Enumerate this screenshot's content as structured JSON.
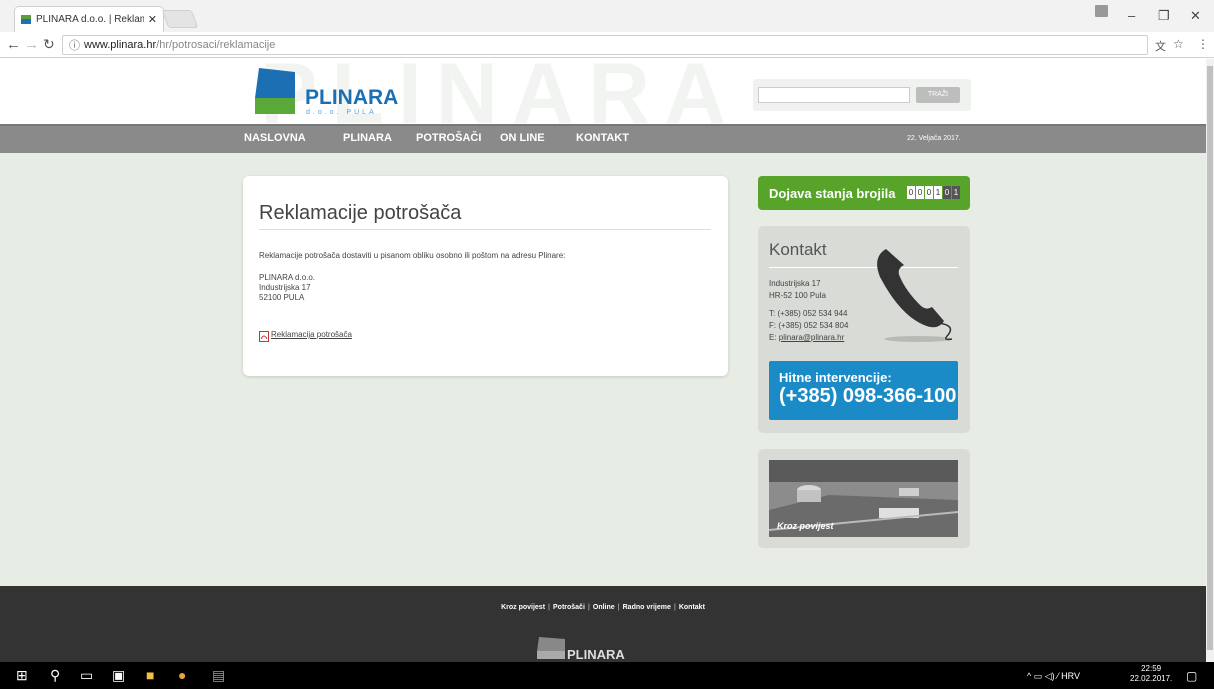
{
  "browser": {
    "tab_title": "PLINARA d.o.o. | Reklamac",
    "url_domain": "www.plinara.hr",
    "url_path": "/hr/potrosaci/reklamacije"
  },
  "header": {
    "watermark": "PLINARA",
    "logo_name": "PLINARA",
    "logo_sub": "d.o.o. PULA",
    "search_button": "TRAŽI",
    "search_value": ""
  },
  "menu": {
    "items": [
      "NASLOVNA",
      "PLINARA",
      "POTROŠAČI",
      "ON LINE",
      "KONTAKT"
    ],
    "date": "22. Veljača 2017."
  },
  "content": {
    "heading": "Reklamacije potrošača",
    "intro": "Reklamacije potrošača dostaviti u pisanom obliku osobno ili poštom na adresu Plinare:",
    "address": [
      "PLINARA d.o.o.",
      "Industrijska 17",
      "52100 PULA"
    ],
    "pdf_link": "Reklamacija potrošača"
  },
  "sidebar": {
    "meter_label": "Dojava stanja brojila",
    "meter_digits": [
      "0",
      "0",
      "0",
      "1",
      "0",
      "1"
    ],
    "kontakt_title": "Kontakt",
    "kontakt_address": [
      "Industrijska 17",
      "HR-52 100 Pula"
    ],
    "kontakt_phone": "T: (+385) 052 534 944",
    "kontakt_fax": "F: (+385) 052 534 804",
    "kontakt_email_prefix": "E: ",
    "kontakt_email": "plinara@plinara.hr",
    "hitne_label": "Hitne intervencije:",
    "hitne_number": "(+385) 098-366-100",
    "povijest_label": "Kroz povijest"
  },
  "footer": {
    "links": [
      "Kroz povijest",
      "Potrošači",
      "Online",
      "Radno vrijeme",
      "Kontakt"
    ],
    "logo_text": "PLINARA"
  },
  "taskbar": {
    "lang": "HRV",
    "time": "22:59",
    "date": "22.02.2017."
  },
  "colors": {
    "brand_blue": "#1d6fb4",
    "brand_green": "#58a32a",
    "emergency_blue": "#1b8bc8",
    "menu_gray": "#8a8a8a"
  }
}
